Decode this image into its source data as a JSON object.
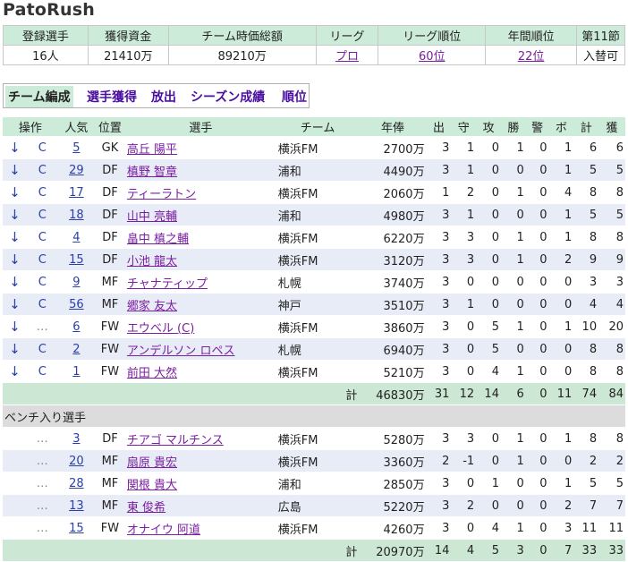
{
  "app_title": "PatoRush",
  "summary": {
    "headers": [
      "登録選手",
      "獲得資金",
      "チーム時価総額",
      "リーグ",
      "リーグ順位",
      "年間順位",
      "第11節"
    ],
    "values": [
      "16人",
      "21410万",
      "89210万",
      "プロ",
      "60位",
      "22位",
      "入替可"
    ]
  },
  "tabs": [
    "チーム編成",
    "選手獲得",
    "放出",
    "シーズン成績",
    "順位"
  ],
  "columns": [
    "操作",
    "人気",
    "位置",
    "選手",
    "チーム",
    "年俸",
    "出",
    "守",
    "攻",
    "勝",
    "警",
    "ボ",
    "計",
    "獲"
  ],
  "starters": [
    {
      "op1": "↓",
      "op2": "C",
      "pop": "5",
      "pos": "GK",
      "name": "高丘 陽平",
      "team": "横浜FM",
      "salary": "2700万",
      "s": [
        "3",
        "1",
        "0",
        "1",
        "0",
        "1",
        "6",
        "6"
      ]
    },
    {
      "op1": "↓",
      "op2": "C",
      "pop": "29",
      "pos": "DF",
      "name": "槙野 智章",
      "team": "浦和",
      "salary": "4490万",
      "s": [
        "3",
        "1",
        "0",
        "0",
        "0",
        "1",
        "5",
        "5"
      ]
    },
    {
      "op1": "↓",
      "op2": "C",
      "pop": "17",
      "pos": "DF",
      "name": "ティーラトン",
      "team": "横浜FM",
      "salary": "2060万",
      "s": [
        "1",
        "2",
        "0",
        "1",
        "0",
        "4",
        "8",
        "8"
      ]
    },
    {
      "op1": "↓",
      "op2": "C",
      "pop": "18",
      "pos": "DF",
      "name": "山中 亮輔",
      "team": "浦和",
      "salary": "4980万",
      "s": [
        "3",
        "1",
        "0",
        "0",
        "0",
        "1",
        "5",
        "5"
      ]
    },
    {
      "op1": "↓",
      "op2": "C",
      "pop": "4",
      "pos": "DF",
      "name": "畠中 槙之輔",
      "team": "横浜FM",
      "salary": "6220万",
      "s": [
        "3",
        "3",
        "0",
        "1",
        "0",
        "1",
        "8",
        "8"
      ]
    },
    {
      "op1": "↓",
      "op2": "C",
      "pop": "15",
      "pos": "DF",
      "name": "小池 龍太",
      "team": "横浜FM",
      "salary": "3120万",
      "s": [
        "3",
        "3",
        "0",
        "1",
        "0",
        "2",
        "9",
        "9"
      ]
    },
    {
      "op1": "↓",
      "op2": "C",
      "pop": "9",
      "pos": "MF",
      "name": "チャナティップ",
      "team": "札幌",
      "salary": "3740万",
      "s": [
        "3",
        "0",
        "0",
        "0",
        "0",
        "0",
        "3",
        "3"
      ]
    },
    {
      "op1": "↓",
      "op2": "C",
      "pop": "56",
      "pos": "MF",
      "name": "郷家 友太",
      "team": "神戸",
      "salary": "3510万",
      "s": [
        "3",
        "1",
        "0",
        "0",
        "0",
        "0",
        "4",
        "4"
      ]
    },
    {
      "op1": "↓",
      "op2": "…",
      "pop": "6",
      "pos": "FW",
      "name": "エウベル (C)",
      "team": "横浜FM",
      "salary": "3860万",
      "s": [
        "3",
        "0",
        "5",
        "1",
        "0",
        "1",
        "10",
        "20"
      ]
    },
    {
      "op1": "↓",
      "op2": "C",
      "pop": "2",
      "pos": "FW",
      "name": "アンデルソン ロペス",
      "team": "札幌",
      "salary": "6940万",
      "s": [
        "3",
        "0",
        "5",
        "0",
        "0",
        "0",
        "8",
        "8"
      ]
    },
    {
      "op1": "↓",
      "op2": "C",
      "pop": "1",
      "pos": "FW",
      "name": "前田 大然",
      "team": "横浜FM",
      "salary": "5210万",
      "s": [
        "3",
        "0",
        "4",
        "1",
        "0",
        "0",
        "8",
        "8"
      ]
    }
  ],
  "starters_total": {
    "label": "計",
    "salary": "46830万",
    "s": [
      "31",
      "12",
      "14",
      "6",
      "0",
      "11",
      "74",
      "84"
    ]
  },
  "bench_title": "ベンチ入り選手",
  "bench": [
    {
      "op1": "",
      "op2": "…",
      "pop": "3",
      "pos": "DF",
      "name": "チアゴ マルチンス",
      "team": "横浜FM",
      "salary": "5280万",
      "s": [
        "3",
        "3",
        "0",
        "1",
        "0",
        "1",
        "8",
        "8"
      ]
    },
    {
      "op1": "",
      "op2": "…",
      "pop": "20",
      "pos": "MF",
      "name": "扇原 貴宏",
      "team": "横浜FM",
      "salary": "3360万",
      "s": [
        "2",
        "-1",
        "0",
        "1",
        "0",
        "0",
        "2",
        "2"
      ]
    },
    {
      "op1": "",
      "op2": "…",
      "pop": "28",
      "pos": "MF",
      "name": "関根 貴大",
      "team": "浦和",
      "salary": "2850万",
      "s": [
        "3",
        "0",
        "1",
        "0",
        "0",
        "1",
        "5",
        "5"
      ]
    },
    {
      "op1": "",
      "op2": "…",
      "pop": "13",
      "pos": "MF",
      "name": "東 俊希",
      "team": "広島",
      "salary": "5220万",
      "s": [
        "3",
        "2",
        "0",
        "0",
        "0",
        "2",
        "7",
        "7"
      ]
    },
    {
      "op1": "",
      "op2": "…",
      "pop": "15",
      "pos": "FW",
      "name": "オナイウ 阿道",
      "team": "横浜FM",
      "salary": "4260万",
      "s": [
        "3",
        "0",
        "4",
        "1",
        "0",
        "3",
        "11",
        "11"
      ]
    }
  ],
  "bench_total": {
    "label": "計",
    "salary": "20970万",
    "s": [
      "14",
      "4",
      "5",
      "3",
      "0",
      "7",
      "33",
      "33"
    ]
  }
}
